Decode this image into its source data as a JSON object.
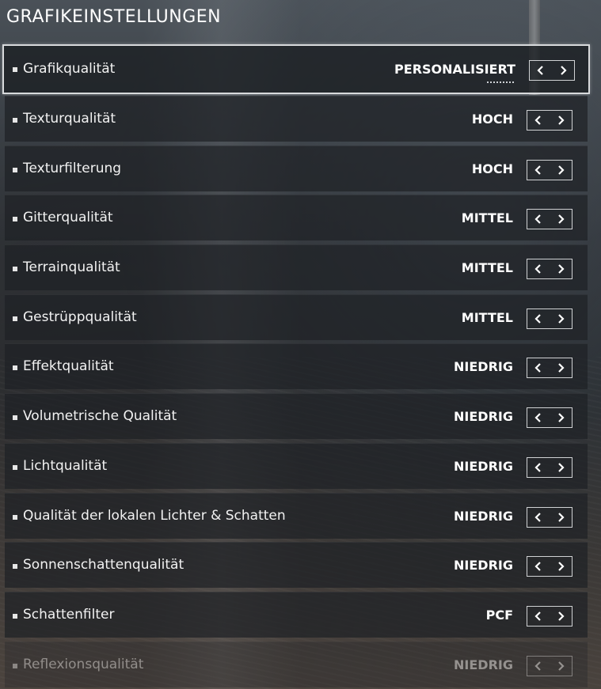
{
  "title": "GRAFIKEINSTELLUNGEN",
  "icons": {
    "left": "chevron-left-icon",
    "right": "chevron-right-icon"
  },
  "colors": {
    "selected_border": "#d8dadc",
    "text": "#ffffff"
  },
  "settings": [
    {
      "label": "Grafikqualität",
      "value": "PERSONALISIERT"
    },
    {
      "label": "Texturqualität",
      "value": "HOCH"
    },
    {
      "label": "Texturfilterung",
      "value": "HOCH"
    },
    {
      "label": "Gitterqualität",
      "value": "MITTEL"
    },
    {
      "label": "Terrainqualität",
      "value": "MITTEL"
    },
    {
      "label": "Gestrüppqualität",
      "value": "MITTEL"
    },
    {
      "label": "Effektqualität",
      "value": "NIEDRIG"
    },
    {
      "label": "Volumetrische Qualität",
      "value": "NIEDRIG"
    },
    {
      "label": "Lichtqualität",
      "value": "NIEDRIG"
    },
    {
      "label": "Qualität der lokalen Lichter & Schatten",
      "value": "NIEDRIG"
    },
    {
      "label": "Sonnenschattenqualität",
      "value": "NIEDRIG"
    },
    {
      "label": "Schattenfilter",
      "value": "PCF"
    },
    {
      "label": "Reflexionsqualität",
      "value": "NIEDRIG"
    }
  ]
}
